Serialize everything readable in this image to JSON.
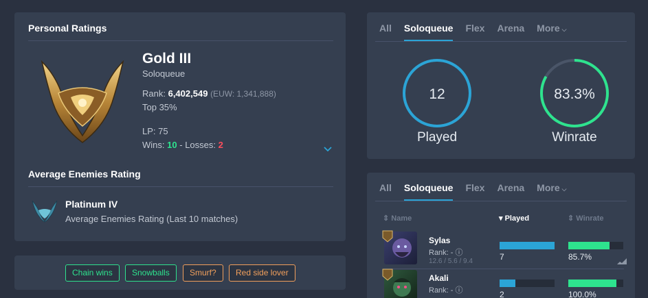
{
  "personal": {
    "title": "Personal Ratings",
    "tier": "Gold III",
    "queue": "Soloqueue",
    "rank_label": "Rank:",
    "rank_value": "6,402,549",
    "rank_region": "(EUW: 1,341,888)",
    "top_percent": "Top 35%",
    "lp": "LP: 75",
    "wins_label": "Wins:",
    "wins": "10",
    "sep": "-",
    "losses_label": "Losses:",
    "losses": "2"
  },
  "enemies": {
    "title": "Average Enemies Rating",
    "tier": "Platinum IV",
    "desc": "Average Enemies Rating (Last 10 matches)"
  },
  "tags": [
    {
      "label": "Chain wins",
      "color": "green"
    },
    {
      "label": "Snowballs",
      "color": "green"
    },
    {
      "label": "Smurf?",
      "color": "orange"
    },
    {
      "label": "Red side lover",
      "color": "orange"
    }
  ],
  "tabs": [
    "All",
    "Soloqueue",
    "Flex",
    "Arena",
    "More"
  ],
  "stats": {
    "played": {
      "value": "12",
      "label": "Played",
      "fraction": 1.0,
      "color": "#2ba4d6"
    },
    "winrate": {
      "value": "83.3%",
      "label": "Winrate",
      "fraction": 0.833,
      "color": "#2ee38e"
    }
  },
  "champions": {
    "headers": {
      "name": "Name",
      "played": "Played",
      "winrate": "Winrate"
    },
    "rows": [
      {
        "name": "Sylas",
        "rank_label": "Rank: -",
        "kda": "12.6 / 5.6 / 9.4",
        "played": "7",
        "played_fraction": 1.0,
        "winrate": "85.7%",
        "winrate_fraction": 0.857
      },
      {
        "name": "Akali",
        "rank_label": "Rank: -",
        "kda": "",
        "played": "2",
        "played_fraction": 0.29,
        "winrate": "100.0%",
        "winrate_fraction": 1.0
      }
    ]
  },
  "colors": {
    "accent": "#2ba4d6",
    "win": "#2ee38e",
    "loss": "#ff4d5c",
    "card": "#353f50",
    "background": "#2a3140"
  }
}
